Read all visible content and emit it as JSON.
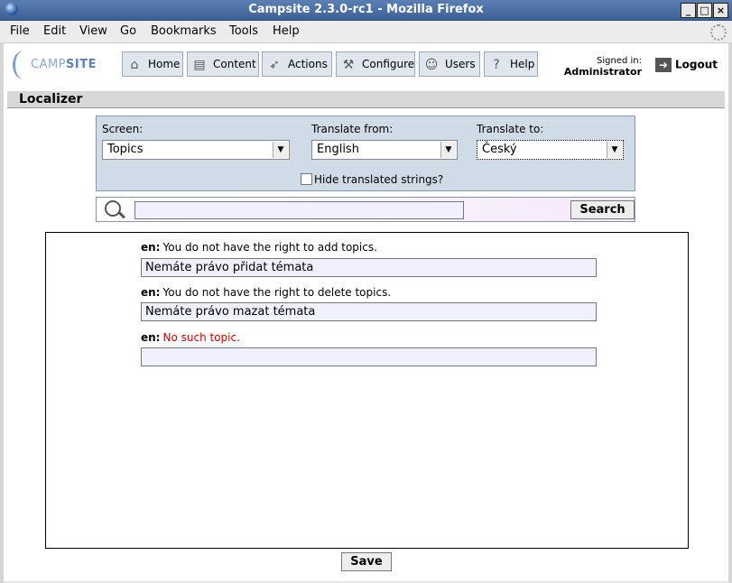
{
  "window": {
    "title": "Campsite 2.3.0-rc1 - Mozilla Firefox"
  },
  "menu": [
    "File",
    "Edit",
    "View",
    "Go",
    "Bookmarks",
    "Tools",
    "Help"
  ],
  "logo": {
    "light": "CAMP",
    "bold": "SITE"
  },
  "nav": {
    "home": "Home",
    "content": "Content",
    "actions": "Actions",
    "configure": "Configure",
    "users": "Users",
    "help": "Help"
  },
  "user": {
    "signed_in_label": "Signed in:",
    "name": "Administrator",
    "logout": "Logout"
  },
  "section": {
    "title": "Localizer"
  },
  "filters": {
    "screen_label": "Screen:",
    "screen_value": "Topics",
    "from_label": "Translate from:",
    "from_value": "English",
    "to_label": "Translate to:",
    "to_value": "Český",
    "hide_label": "Hide translated strings?"
  },
  "search": {
    "value": "",
    "button": "Search"
  },
  "strings": [
    {
      "lang": "en:",
      "source": "You do not have the right to add topics.",
      "translation": "Nemáte právo přidat témata"
    },
    {
      "lang": "en:",
      "source": "You do not have the right to delete topics.",
      "translation": "Nemáte právo mazat témata"
    },
    {
      "lang": "en:",
      "source": "No such topic.",
      "translation": ""
    }
  ],
  "save_label": "Save",
  "colors": {
    "untranslated_source": "#d00000",
    "panel_bg": "#d0dbe8",
    "input_bg": "#f0f0ff"
  }
}
